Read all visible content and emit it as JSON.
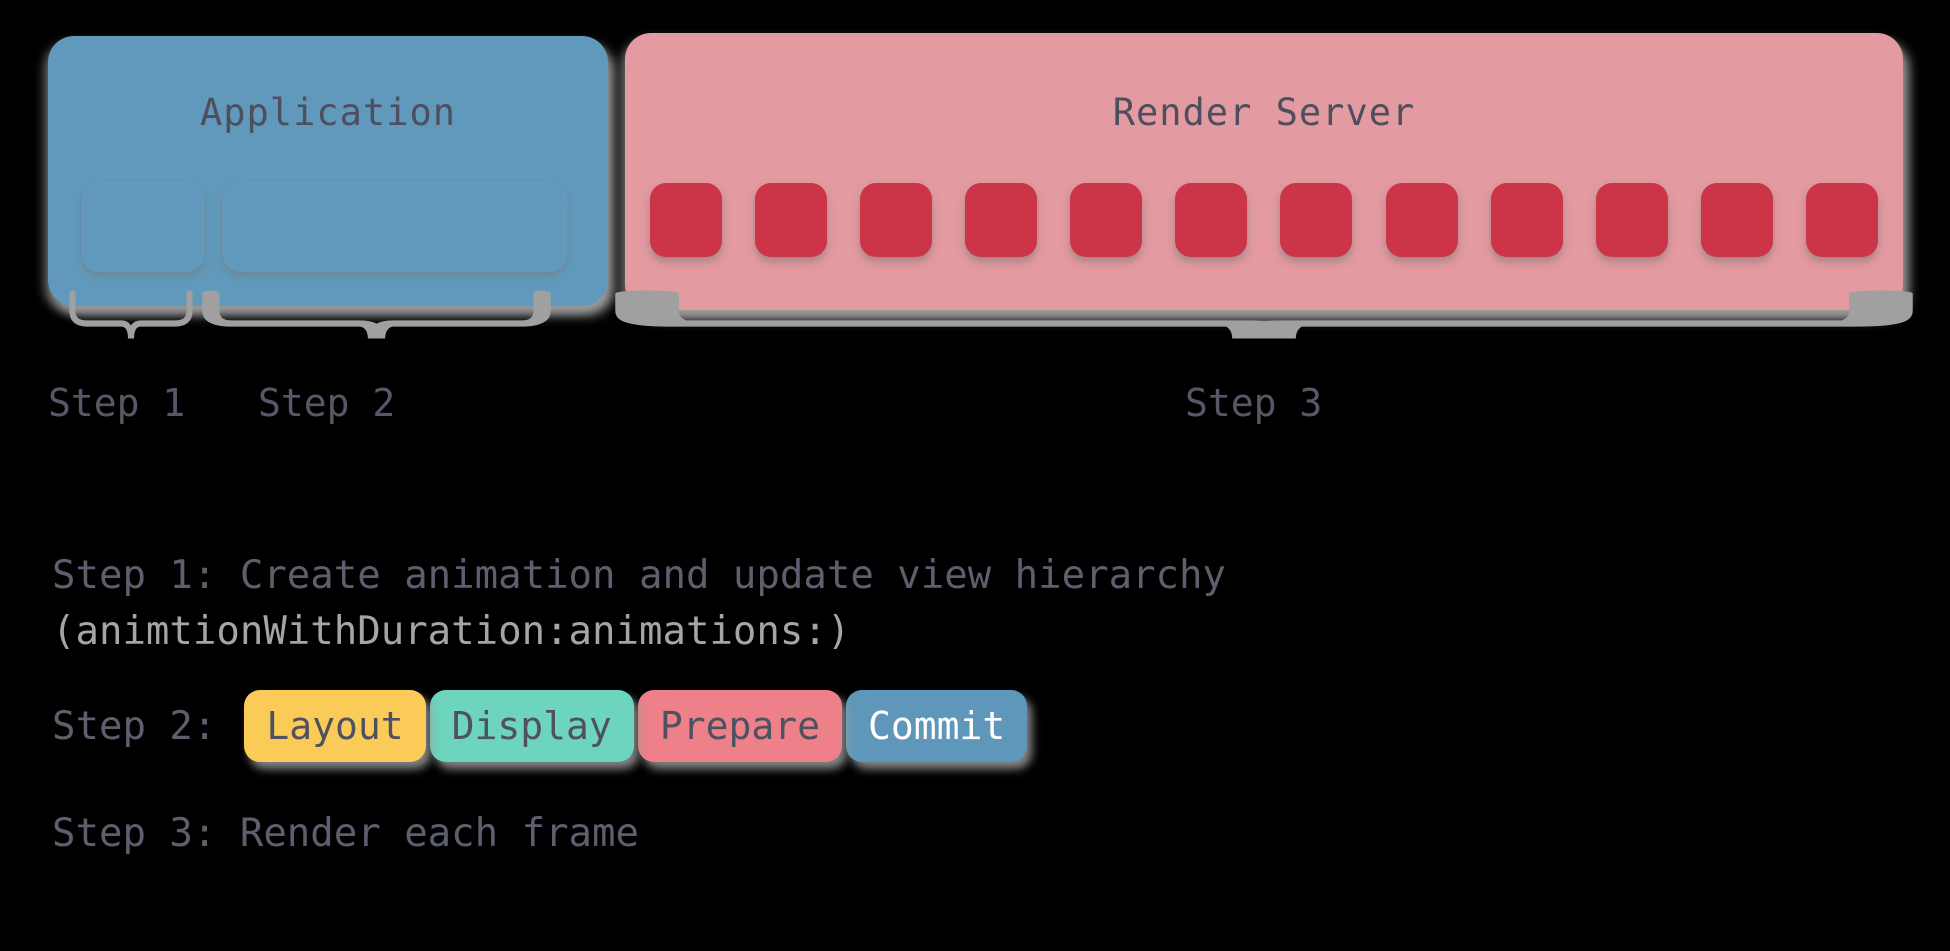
{
  "theme": {
    "background": "#000000",
    "app_panel_color": "#6099bb",
    "render_panel_color": "#e39aa1",
    "frame_cell_color": "#cc3548",
    "text_color": "#5d5f6e",
    "dim_text_color": "#a5a5a8",
    "brace_color": "#a0a0a0",
    "layout_color": "#fbcb58",
    "display_color": "#6dd4bd",
    "prepare_color": "#ed8088",
    "commit_color": "#5f97ba",
    "commit_text_color": "#ffffff"
  },
  "diagram": {
    "app_panel": {
      "title": "Application",
      "subboxes": [
        {
          "name": "step-1-region"
        },
        {
          "name": "step-2-region"
        }
      ]
    },
    "render_panel": {
      "title": "Render Server",
      "frame_count": 12,
      "frames": [
        "frame-1",
        "frame-2",
        "frame-3",
        "frame-4",
        "frame-5",
        "frame-6",
        "frame-7",
        "frame-8",
        "frame-9",
        "frame-10",
        "frame-11",
        "frame-12"
      ]
    },
    "brace_labels": [
      "Step 1",
      "Step 2",
      "Step 3"
    ]
  },
  "legend": {
    "step1_line1": "Step 1: Create animation and update view hierarchy",
    "step1_line2": "(animtionWithDuration:animations:)",
    "step2_label": "Step 2:",
    "pipeline": [
      {
        "label": "Layout"
      },
      {
        "label": "Display"
      },
      {
        "label": "Prepare"
      },
      {
        "label": "Commit"
      }
    ],
    "step3_line": "Step 3: Render each frame"
  },
  "chart_data": {
    "type": "diagram",
    "title": "Core Animation render pipeline",
    "actors": [
      "Application",
      "Render Server"
    ],
    "phases": [
      {
        "step": "Step 1",
        "owner": "Application",
        "description": "Create animation and update view hierarchy (animtionWithDuration:animations:)"
      },
      {
        "step": "Step 2",
        "owner": "Application",
        "description": "Layout, Display, Prepare, Commit"
      },
      {
        "step": "Step 3",
        "owner": "Render Server",
        "description": "Render each frame",
        "frames": 12
      }
    ]
  }
}
